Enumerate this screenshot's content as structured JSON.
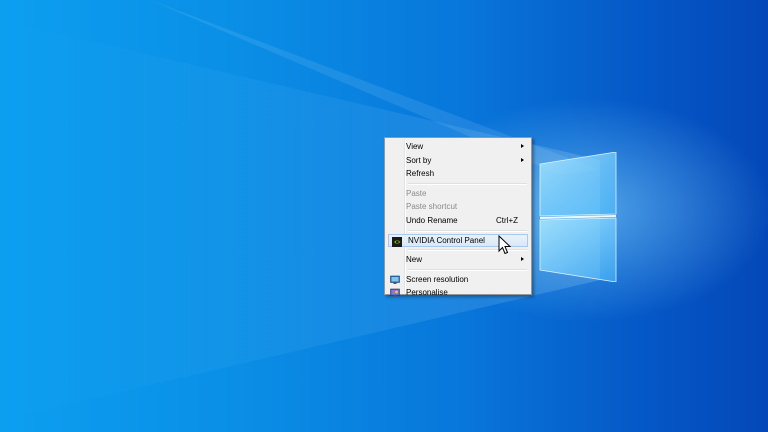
{
  "context_menu": {
    "items": [
      {
        "label": "View",
        "submenu": true
      },
      {
        "label": "Sort by",
        "submenu": true
      },
      {
        "label": "Refresh"
      },
      {
        "label": "Paste",
        "disabled": true
      },
      {
        "label": "Paste shortcut",
        "disabled": true
      },
      {
        "label": "Undo Rename",
        "shortcut": "Ctrl+Z"
      },
      {
        "label": "NVIDIA Control Panel",
        "icon": "nvidia-icon",
        "highlighted": true
      },
      {
        "label": "New",
        "submenu": true
      },
      {
        "label": "Screen resolution",
        "icon": "monitor-icon"
      },
      {
        "label": "Personalise",
        "icon": "personalise-icon"
      }
    ]
  },
  "colors": {
    "desktop_bg": "#0a8fe6",
    "menu_bg": "#f0f0f0",
    "highlight": "#d9e8f7",
    "nvidia_green": "#76b900"
  }
}
